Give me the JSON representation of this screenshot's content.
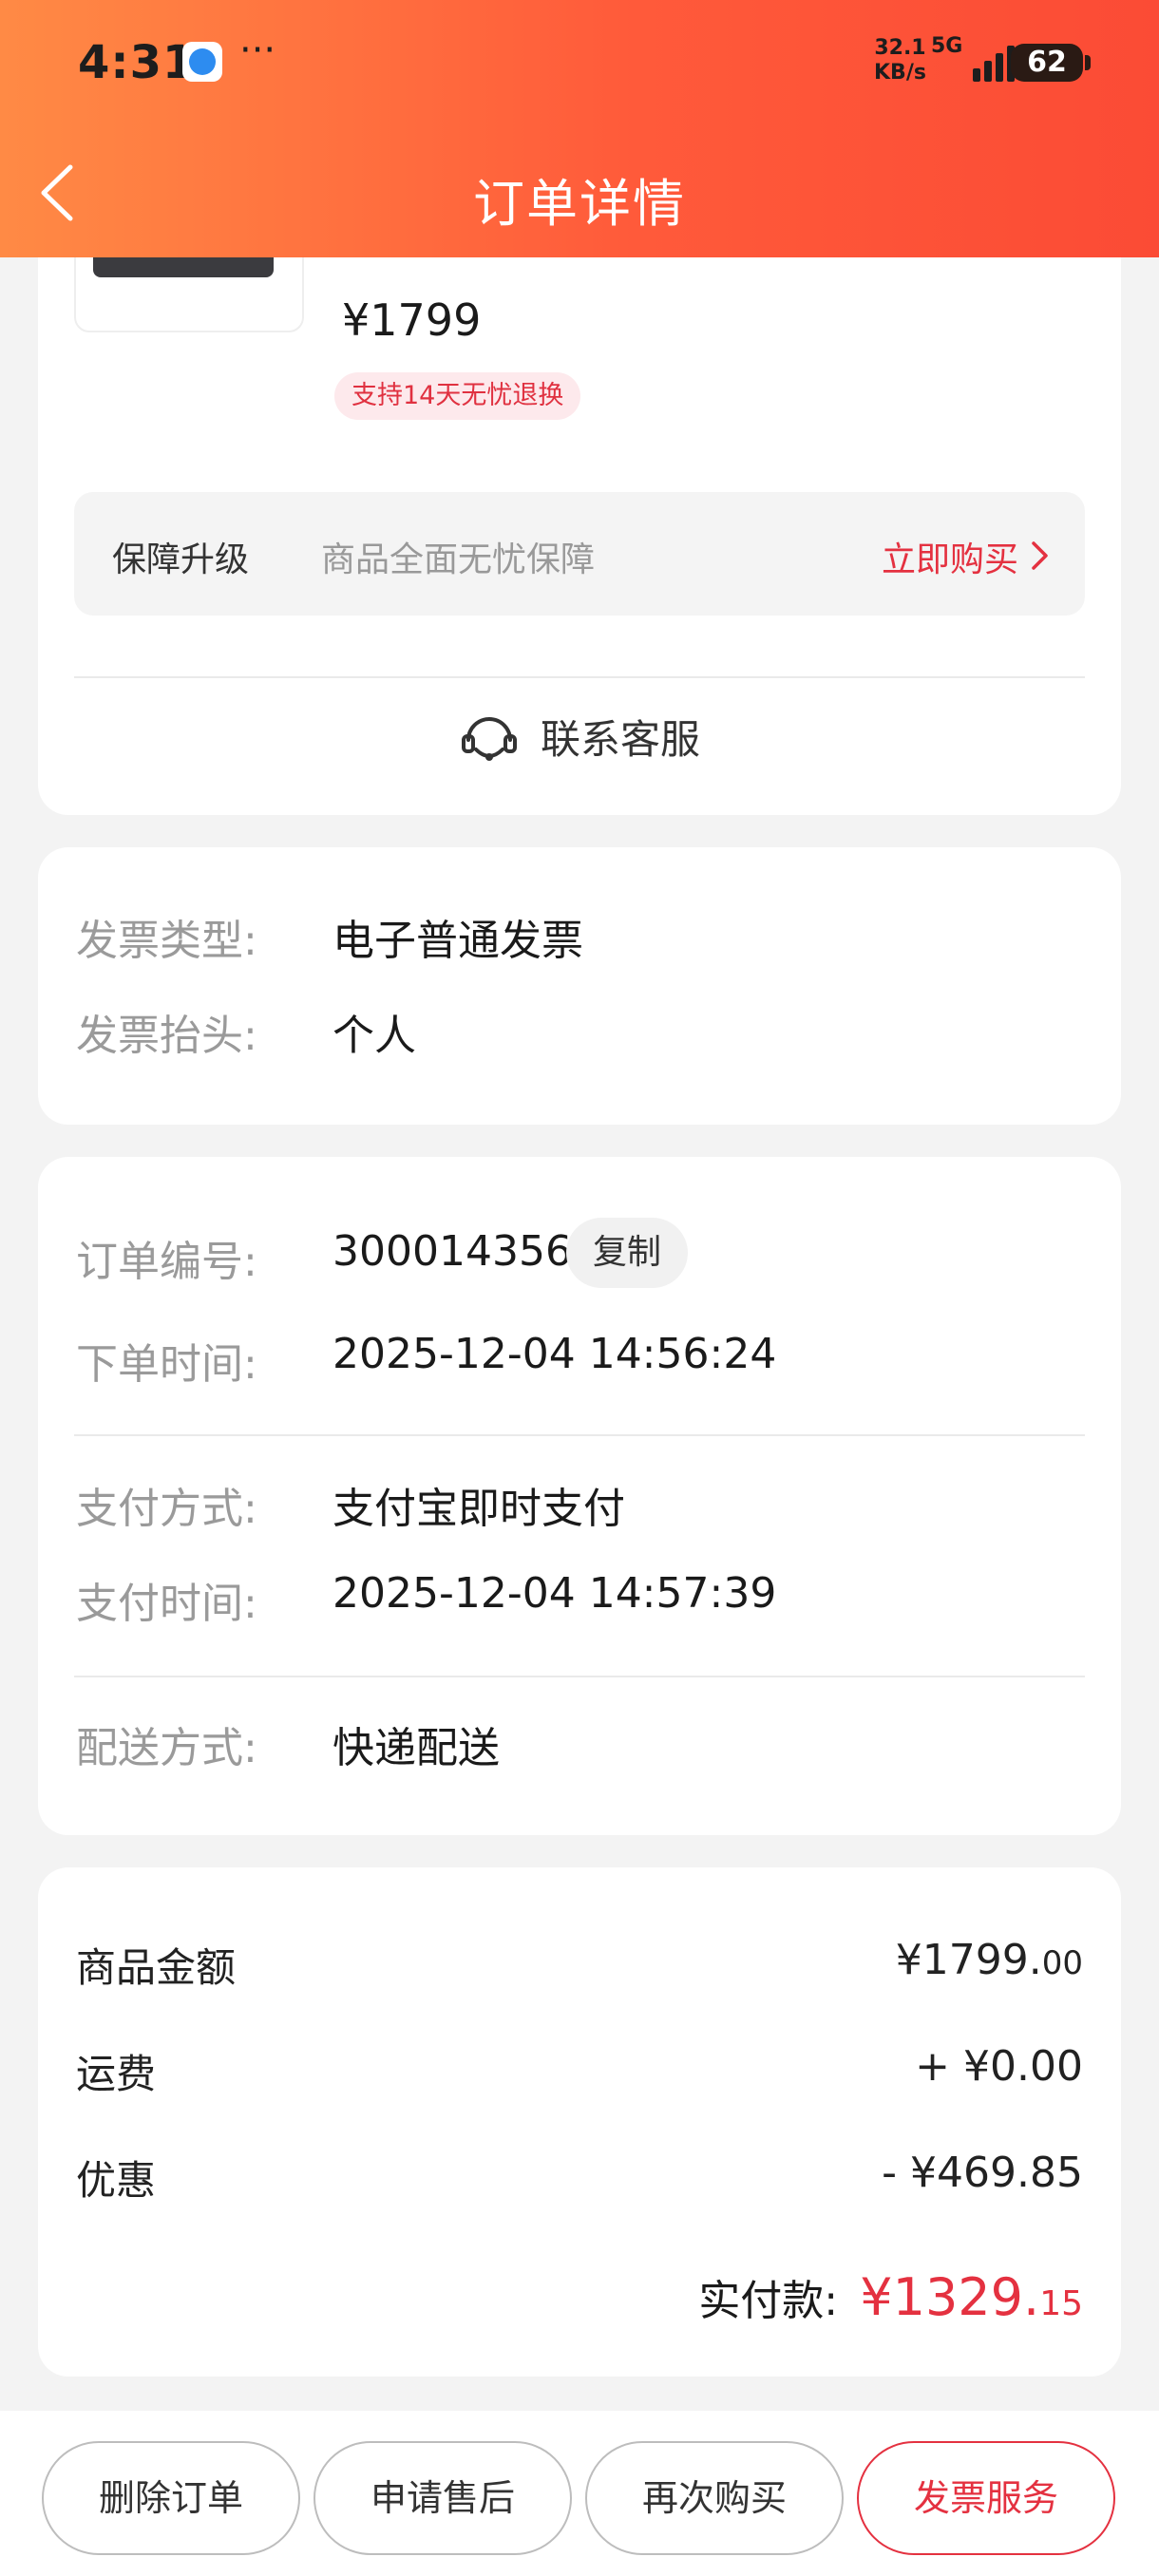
{
  "status_bar": {
    "time": "4:31",
    "more": "···",
    "net_speed_value": "32.1",
    "net_speed_unit": "KB/s",
    "network": "5G",
    "battery": "62"
  },
  "header": {
    "title": "订单详情"
  },
  "product": {
    "price": "¥1799",
    "return_badge": "支持14天无忧退换"
  },
  "guarantee": {
    "title": "保障升级",
    "description": "商品全面无忧保障",
    "action": "立即购买"
  },
  "service": {
    "label": "联系客服"
  },
  "invoice": {
    "type_label": "发票类型:",
    "type_value": "电子普通发票",
    "header_label": "发票抬头:",
    "header_value": "个人"
  },
  "order": {
    "number_label": "订单编号:",
    "number_value": "300014356",
    "copy_label": "复制",
    "order_time_label": "下单时间:",
    "order_time_value": "2025-12-04 14:56:24",
    "pay_method_label": "支付方式:",
    "pay_method_value": "支付宝即时支付",
    "pay_time_label": "支付时间:",
    "pay_time_value": "2025-12-04 14:57:39",
    "delivery_label": "配送方式:",
    "delivery_value": "快递配送"
  },
  "summary": {
    "goods_label": "商品金额",
    "goods_value_main": "¥1799.",
    "goods_value_cents": "00",
    "shipping_label": "运费",
    "shipping_value": "+ ¥0.00",
    "discount_label": "优惠",
    "discount_value": "- ¥469.85",
    "total_label": "实付款:",
    "total_value_main": "¥1329.",
    "total_value_cents": "15"
  },
  "bottom_actions": {
    "delete": "删除订单",
    "after_sale": "申请售后",
    "buy_again": "再次购买",
    "invoice_service": "发票服务"
  },
  "colors": {
    "header_gradient_start": "#ff8a45",
    "header_gradient_end": "#fb4b35",
    "accent_red": "#e43140"
  }
}
